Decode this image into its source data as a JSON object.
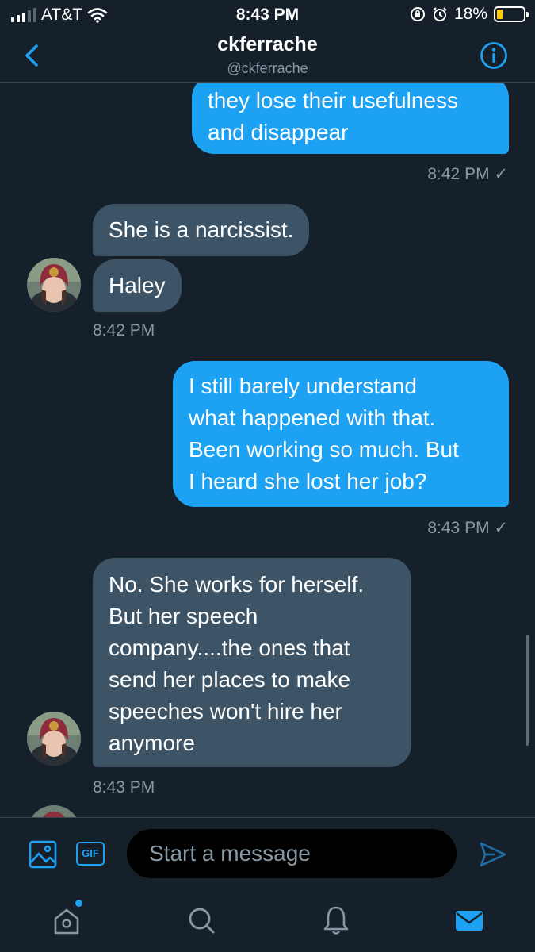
{
  "status": {
    "carrier": "AT&T",
    "time": "8:43 PM",
    "battery": "18%"
  },
  "header": {
    "name": "ckferrache",
    "handle": "@ckferrache"
  },
  "messages": [
    {
      "from": "me",
      "text_lines": [
        "they lose their usefulness",
        "and disappear"
      ],
      "time": "8:42 PM ✓"
    },
    {
      "from": "them",
      "text": "She is a narcissist."
    },
    {
      "from": "them",
      "text": "Haley",
      "time": "8:42 PM"
    },
    {
      "from": "me",
      "text_lines": [
        "I still barely understand",
        "what happened with that.",
        "Been working so much. But",
        "I heard she lost her job?"
      ],
      "time": "8:43 PM ✓"
    },
    {
      "from": "them",
      "text_lines": [
        "No. She works for herself.",
        "But her speech",
        "company....the ones that",
        "send her places to make",
        "speeches won't hire her",
        "anymore"
      ],
      "time": "8:43 PM"
    }
  ],
  "composer": {
    "placeholder": "Start a message",
    "gif_label": "GIF"
  },
  "icons": {
    "back": "chevron-left-icon",
    "info": "info-icon",
    "image": "image-icon",
    "send": "send-icon",
    "tabs": [
      "home-icon",
      "search-icon",
      "bell-icon",
      "mail-icon"
    ]
  },
  "colors": {
    "background": "#15202b",
    "accent": "#1da1f2",
    "incoming_bubble": "#3d5466",
    "muted": "#8899a6",
    "battery": "#ffcc00"
  }
}
